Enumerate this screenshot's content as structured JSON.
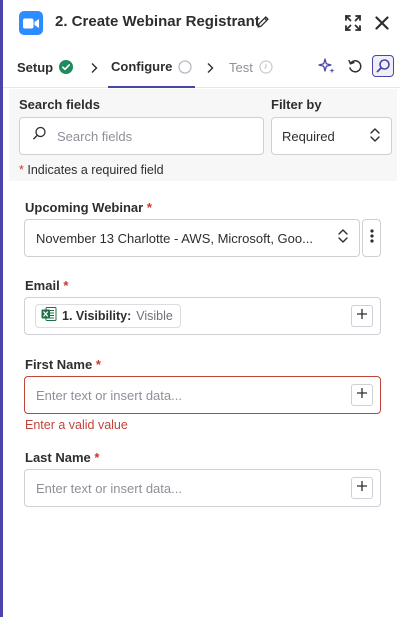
{
  "header": {
    "title": "2. Create Webinar Registrant"
  },
  "tabs": [
    {
      "label": "Setup",
      "status": "complete"
    },
    {
      "label": "Configure",
      "status": "pending"
    },
    {
      "label": "Test",
      "status": "disabled"
    }
  ],
  "search": {
    "label": "Search fields",
    "placeholder": "Search fields"
  },
  "filter": {
    "label": "Filter by",
    "value": "Required"
  },
  "required_note": {
    "star": "*",
    "text": "Indicates a required field"
  },
  "fields": {
    "webinar": {
      "label": "Upcoming Webinar",
      "required_star": "*",
      "value": "November 13 Charlotte - AWS, Microsoft, Goo..."
    },
    "email": {
      "label": "Email",
      "required_star": "*",
      "pill_step": "1. Visibility:",
      "pill_value": "Visible"
    },
    "first_name": {
      "label": "First Name",
      "required_star": "*",
      "placeholder": "Enter text or insert data...",
      "error": "Enter a valid value"
    },
    "last_name": {
      "label": "Last Name",
      "required_star": "*",
      "placeholder": "Enter text or insert data..."
    }
  },
  "colors": {
    "accent": "#4a44a8",
    "app_icon": "#2d8cff",
    "success": "#1f8a5b",
    "error": "#c1443a",
    "excel": "#1d7044"
  },
  "icons": {
    "app": "zoom-video-icon",
    "edit": "pencil-icon",
    "expand": "expand-icon",
    "close": "close-icon",
    "ai": "sparkle-icon",
    "refresh": "refresh-icon",
    "search": "search-icon"
  }
}
